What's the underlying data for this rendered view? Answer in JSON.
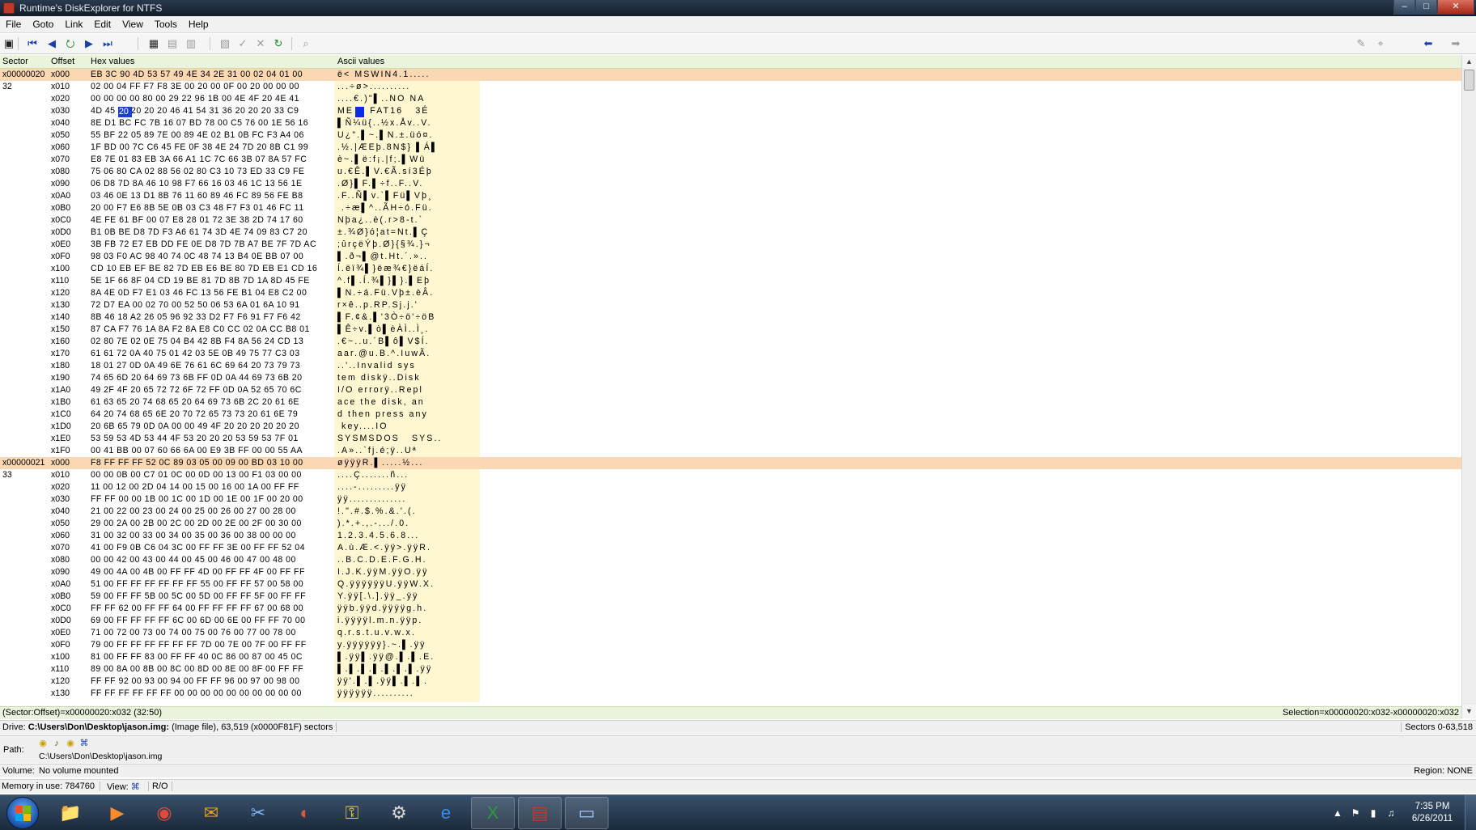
{
  "window": {
    "title": "Runtime's DiskExplorer for NTFS",
    "controls": [
      "minimize",
      "maximize",
      "close"
    ]
  },
  "menu": [
    "File",
    "Goto",
    "Link",
    "Edit",
    "View",
    "Tools",
    "Help"
  ],
  "toolbar": {
    "buttons": [
      {
        "icon": "save-icon",
        "glyph": "▣",
        "color": "dark"
      },
      {
        "icon": "first-icon",
        "glyph": "⏮",
        "color": "blue"
      },
      {
        "icon": "prev-icon",
        "glyph": "◀",
        "color": "blue"
      },
      {
        "icon": "goto-icon",
        "glyph": "⭮",
        "color": "green"
      },
      {
        "icon": "next-icon",
        "glyph": "▶",
        "color": "blue"
      },
      {
        "icon": "last-icon",
        "glyph": "⏭",
        "color": "blue"
      },
      {
        "icon": "bookmark-icon",
        "glyph": "▦",
        "color": "dark"
      },
      {
        "icon": "copy-icon",
        "glyph": "▤",
        "color": "gray"
      },
      {
        "icon": "paste-icon",
        "glyph": "▥",
        "color": "gray"
      },
      {
        "icon": "write-icon",
        "glyph": "▧",
        "color": "gray"
      },
      {
        "icon": "check-icon",
        "glyph": "✓",
        "color": "gray"
      },
      {
        "icon": "cancel-icon",
        "glyph": "✕",
        "color": "gray"
      },
      {
        "icon": "refresh-icon",
        "glyph": "↻",
        "color": "green"
      },
      {
        "icon": "find-icon",
        "glyph": "⌕",
        "color": "gray"
      }
    ],
    "right_buttons": [
      {
        "icon": "pin-icon",
        "glyph": "✎",
        "color": "gray"
      },
      {
        "icon": "select-icon",
        "glyph": "⌖",
        "color": "gray"
      },
      {
        "icon": "back-arrow-icon",
        "glyph": "⬅",
        "color": "blue"
      },
      {
        "icon": "forward-arrow-icon",
        "glyph": "➡",
        "color": "gray"
      }
    ]
  },
  "grid": {
    "headers": {
      "sector": "Sector",
      "offset": "Offset",
      "hex": "Hex values",
      "ascii": "Ascii values"
    },
    "selected_byte": "20",
    "rows": [
      {
        "sector": "x00000020",
        "offset": "x000",
        "hex": "EB 3C 90 4D 53 57 49 4E 34 2E 31 00 02 04 01 00",
        "ascii": "ë< MSWIN4.1.....",
        "hl": true
      },
      {
        "sector": "32",
        "offset": "x010",
        "hex": "02 00 04 FF F7 F8 3E 00 20 00 0F 00 20 00 00 00",
        "ascii": "...÷ø>.........."
      },
      {
        "sector": "",
        "offset": "x020",
        "hex": "00 00 00 00 80 00 29 22 96 1B 00 4E 4F 20 4E 41",
        "ascii": "....€.)\"▌..NO NA"
      },
      {
        "sector": "",
        "offset": "x030",
        "hex": "4D 45 20 20 20 20 46 41 54 31 36 20 20 20 33 C9",
        "ascii": "ME    FAT16   3É"
      },
      {
        "sector": "",
        "offset": "x040",
        "hex": "8E D1 BC FC 7B 16 07 BD 78 00 C5 76 00 1E 56 16",
        "ascii": "▌Ñ¼ü{..½x.Åv..V."
      },
      {
        "sector": "",
        "offset": "x050",
        "hex": "55 BF 22 05 89 7E 00 89 4E 02 B1 0B FC F3 A4 06",
        "ascii": "U¿\".▌~.▌N.±.üó¤."
      },
      {
        "sector": "",
        "offset": "x060",
        "hex": "1F BD 00 7C C6 45 FE 0F 38 4E 24 7D 20 8B C1 99",
        "ascii": ".½.|ÆEþ.8N$} ▌Á▌"
      },
      {
        "sector": "",
        "offset": "x070",
        "hex": "E8 7E 01 83 EB 3A 66 A1 1C 7C 66 3B 07 8A 57 FC",
        "ascii": "è~.▌ë:f¡.|f;.▌Wü"
      },
      {
        "sector": "",
        "offset": "x080",
        "hex": "75 06 80 CA 02 88 56 02 80 C3 10 73 ED 33 C9 FE",
        "ascii": "u.€Ê.▌V.€Ã.sí3Éþ"
      },
      {
        "sector": "",
        "offset": "x090",
        "hex": "06 D8 7D 8A 46 10 98 F7 66 16 03 46 1C 13 56 1E",
        "ascii": ".Ø}▌F.▌÷f..F..V."
      },
      {
        "sector": "",
        "offset": "x0A0",
        "hex": "03 46 0E 13 D1 8B 76 11 60 89 46 FC 89 56 FE B8",
        "ascii": ".F..Ñ▌v.`▌Fü▌Vþ¸"
      },
      {
        "sector": "",
        "offset": "x0B0",
        "hex": "20 00 F7 E6 8B 5E 0B 03 C3 48 F7 F3 01 46 FC 11",
        "ascii": " .÷æ▌^..ÃH÷ó.Fü."
      },
      {
        "sector": "",
        "offset": "x0C0",
        "hex": "4E FE 61 BF 00 07 E8 28 01 72 3E 38 2D 74 17 60",
        "ascii": "Nþa¿..è(.r>8-t.`"
      },
      {
        "sector": "",
        "offset": "x0D0",
        "hex": "B1 0B BE D8 7D F3 A6 61 74 3D 4E 74 09 83 C7 20",
        "ascii": "±.¾Ø}ó¦at=Nt.▌Ç "
      },
      {
        "sector": "",
        "offset": "x0E0",
        "hex": "3B FB 72 E7 EB DD FE 0E D8 7D 7B A7 BE 7F 7D AC",
        "ascii": ";ûrçëÝþ.Ø}{§¾.}¬"
      },
      {
        "sector": "",
        "offset": "x0F0",
        "hex": "98 03 F0 AC 98 40 74 0C 48 74 13 B4 0E BB 07 00",
        "ascii": "▌.ð¬▌@t.Ht.´.».."
      },
      {
        "sector": "",
        "offset": "x100",
        "hex": "CD 10 EB EF BE 82 7D EB E6 BE 80 7D EB E1 CD 16",
        "ascii": "Í.ëï¾▌}ëæ¾€}ëáÍ."
      },
      {
        "sector": "",
        "offset": "x110",
        "hex": "5E 1F 66 8F 04 CD 19 BE 81 7D 8B 7D 1A 8D 45 FE",
        "ascii": "^.f▌.Í.¾▌}▌}.▌Eþ"
      },
      {
        "sector": "",
        "offset": "x120",
        "hex": "8A 4E 0D F7 E1 03 46 FC 13 56 FE B1 04 E8 C2 00",
        "ascii": "▌N.÷á.Fü.Vþ±.èÂ."
      },
      {
        "sector": "",
        "offset": "x130",
        "hex": "72 D7 EA 00 02 70 00 52 50 06 53 6A 01 6A 10 91",
        "ascii": "r×ê..p.RP.Sj.j.'"
      },
      {
        "sector": "",
        "offset": "x140",
        "hex": "8B 46 18 A2 26 05 96 92 33 D2 F7 F6 91 F7 F6 42",
        "ascii": "▌F.¢&.▌'3Ò÷ö'÷öB"
      },
      {
        "sector": "",
        "offset": "x150",
        "hex": "87 CA F7 76 1A 8A F2 8A E8 C0 CC 02 0A CC B8 01",
        "ascii": "▌Ê÷v.▌ò▌èÀÌ..Ì¸."
      },
      {
        "sector": "",
        "offset": "x160",
        "hex": "02 80 7E 02 0E 75 04 B4 42 8B F4 8A 56 24 CD 13",
        "ascii": ".€~..u.´B▌ô▌V$Í."
      },
      {
        "sector": "",
        "offset": "x170",
        "hex": "61 61 72 0A 40 75 01 42 03 5E 0B 49 75 77 C3 03",
        "ascii": "aar.@u.B.^.IuwÃ."
      },
      {
        "sector": "",
        "offset": "x180",
        "hex": "18 01 27 0D 0A 49 6E 76 61 6C 69 64 20 73 79 73",
        "ascii": "..'..Invalid sys"
      },
      {
        "sector": "",
        "offset": "x190",
        "hex": "74 65 6D 20 64 69 73 6B FF 0D 0A 44 69 73 6B 20",
        "ascii": "tem diskÿ..Disk "
      },
      {
        "sector": "",
        "offset": "x1A0",
        "hex": "49 2F 4F 20 65 72 72 6F 72 FF 0D 0A 52 65 70 6C",
        "ascii": "I/O errorÿ..Repl"
      },
      {
        "sector": "",
        "offset": "x1B0",
        "hex": "61 63 65 20 74 68 65 20 64 69 73 6B 2C 20 61 6E",
        "ascii": "ace the disk, an"
      },
      {
        "sector": "",
        "offset": "x1C0",
        "hex": "64 20 74 68 65 6E 20 70 72 65 73 73 20 61 6E 79",
        "ascii": "d then press any"
      },
      {
        "sector": "",
        "offset": "x1D0",
        "hex": "20 6B 65 79 0D 0A 00 00 49 4F 20 20 20 20 20 20",
        "ascii": " key....IO      "
      },
      {
        "sector": "",
        "offset": "x1E0",
        "hex": "53 59 53 4D 53 44 4F 53 20 20 20 53 59 53 7F 01",
        "ascii": "SYSMSDOS   SYS.."
      },
      {
        "sector": "",
        "offset": "x1F0",
        "hex": "00 41 BB 00 07 60 66 6A 00 E9 3B FF 00 00 55 AA",
        "ascii": ".A»..`fj.é;ÿ..Uª"
      },
      {
        "sector": "x00000021",
        "offset": "x000",
        "hex": "F8 FF FF FF 52 0C 89 03 05 00 09 00 BD 03 10 00",
        "ascii": "øÿÿÿR.▌.....½...",
        "hl": true
      },
      {
        "sector": "33",
        "offset": "x010",
        "hex": "00 00 0B 00 C7 01 0C 00 0D 00 13 00 F1 03 00 00",
        "ascii": "....Ç.......ñ..."
      },
      {
        "sector": "",
        "offset": "x020",
        "hex": "11 00 12 00 2D 04 14 00 15 00 16 00 1A 00 FF FF",
        "ascii": "....-.........ÿÿ"
      },
      {
        "sector": "",
        "offset": "x030",
        "hex": "FF FF 00 00 1B 00 1C 00 1D 00 1E 00 1F 00 20 00",
        "ascii": "ÿÿ.............."
      },
      {
        "sector": "",
        "offset": "x040",
        "hex": "21 00 22 00 23 00 24 00 25 00 26 00 27 00 28 00",
        "ascii": "!.\".#.$.%.&.'.(."
      },
      {
        "sector": "",
        "offset": "x050",
        "hex": "29 00 2A 00 2B 00 2C 00 2D 00 2E 00 2F 00 30 00",
        "ascii": ").*.+.,.-.../.0."
      },
      {
        "sector": "",
        "offset": "x060",
        "hex": "31 00 32 00 33 00 34 00 35 00 36 00 38 00 00 00",
        "ascii": "1.2.3.4.5.6.8..."
      },
      {
        "sector": "",
        "offset": "x070",
        "hex": "41 00 F9 0B C6 04 3C 00 FF FF 3E 00 FF FF 52 04",
        "ascii": "A.ù.Æ.<.ÿÿ>.ÿÿR."
      },
      {
        "sector": "",
        "offset": "x080",
        "hex": "00 00 42 00 43 00 44 00 45 00 46 00 47 00 48 00",
        "ascii": "..B.C.D.E.F.G.H."
      },
      {
        "sector": "",
        "offset": "x090",
        "hex": "49 00 4A 00 4B 00 FF FF 4D 00 FF FF 4F 00 FF FF",
        "ascii": "I.J.K.ÿÿM.ÿÿO.ÿÿ"
      },
      {
        "sector": "",
        "offset": "x0A0",
        "hex": "51 00 FF FF FF FF FF FF 55 00 FF FF 57 00 58 00",
        "ascii": "Q.ÿÿÿÿÿÿU.ÿÿW.X."
      },
      {
        "sector": "",
        "offset": "x0B0",
        "hex": "59 00 FF FF 5B 00 5C 00 5D 00 FF FF 5F 00 FF FF",
        "ascii": "Y.ÿÿ[.\\.].ÿÿ_.ÿÿ"
      },
      {
        "sector": "",
        "offset": "x0C0",
        "hex": "FF FF 62 00 FF FF 64 00 FF FF FF FF 67 00 68 00",
        "ascii": "ÿÿb.ÿÿd.ÿÿÿÿg.h."
      },
      {
        "sector": "",
        "offset": "x0D0",
        "hex": "69 00 FF FF FF FF 6C 00 6D 00 6E 00 FF FF 70 00",
        "ascii": "i.ÿÿÿÿl.m.n.ÿÿp."
      },
      {
        "sector": "",
        "offset": "x0E0",
        "hex": "71 00 72 00 73 00 74 00 75 00 76 00 77 00 78 00",
        "ascii": "q.r.s.t.u.v.w.x."
      },
      {
        "sector": "",
        "offset": "x0F0",
        "hex": "79 00 FF FF FF FF FF FF 7D 00 7E 00 7F 00 FF FF",
        "ascii": "y.ÿÿÿÿÿÿ}.~.▌.ÿÿ"
      },
      {
        "sector": "",
        "offset": "x100",
        "hex": "81 00 FF FF 83 00 FF FF 40 0C 86 00 87 00 45 0C",
        "ascii": "▌.ÿÿ▌.ÿÿ@.▌.▌.E."
      },
      {
        "sector": "",
        "offset": "x110",
        "hex": "89 00 8A 00 8B 00 8C 00 8D 00 8E 00 8F 00 FF FF",
        "ascii": "▌.▌.▌.▌.▌.▌.▌.ÿÿ"
      },
      {
        "sector": "",
        "offset": "x120",
        "hex": "FF FF 92 00 93 00 94 00 FF FF 96 00 97 00 98 00",
        "ascii": "ÿÿ'.▌.▌.ÿÿ▌.▌.▌."
      },
      {
        "sector": "",
        "offset": "x130",
        "hex": "FF FF FF FF FF FF 00 00 00 00 00 00 00 00 00 00",
        "ascii": "ÿÿÿÿÿÿ.........."
      }
    ]
  },
  "status": {
    "position": "(Sector:Offset)=x00000020:x032 (32:50)",
    "selection": "Selection=x00000020:x032-x00000020:x032"
  },
  "drive": {
    "label": "Drive:",
    "path": "C:\\Users\\Don\\Desktop\\jason.img:",
    "info": "(Image file), 63,519 (x0000F81F) sectors",
    "sectors": "Sectors 0-63,518"
  },
  "path": {
    "label": "Path:",
    "value": "C:\\Users\\Don\\Desktop\\jason.img"
  },
  "volume": {
    "label": "Volume:",
    "value": "No volume mounted",
    "region": "Region:   NONE"
  },
  "memory": {
    "text": "Memory in use: 784760",
    "view": "View:",
    "ro": "R/O"
  },
  "taskbar": {
    "apps": [
      {
        "name": "explorer-task",
        "glyph": "📁"
      },
      {
        "name": "media-player-task",
        "glyph": "▶"
      },
      {
        "name": "chrome-task",
        "glyph": "◉"
      },
      {
        "name": "outlook-task",
        "glyph": "✉"
      },
      {
        "name": "snipping-task",
        "glyph": "✂"
      },
      {
        "name": "app-task",
        "glyph": "◐"
      },
      {
        "name": "key-task",
        "glyph": "⚿"
      },
      {
        "name": "settings-task",
        "glyph": "⚙"
      },
      {
        "name": "ie-task",
        "glyph": "e"
      },
      {
        "name": "excel-task",
        "glyph": "X"
      },
      {
        "name": "diskexplorer-task",
        "glyph": "▤"
      },
      {
        "name": "window-task",
        "glyph": "▭"
      }
    ],
    "time": "7:35 PM",
    "date": "6/26/2011"
  }
}
